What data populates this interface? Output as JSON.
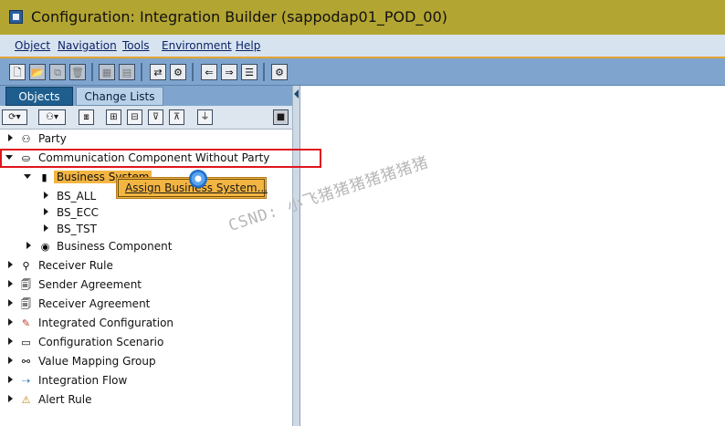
{
  "window": {
    "title": "Configuration: Integration Builder (sappodap01_POD_00)"
  },
  "menubar": {
    "items": [
      {
        "label": "Object"
      },
      {
        "label": "Navigation"
      },
      {
        "label": "Tools"
      },
      {
        "label": "Environment"
      },
      {
        "label": "Help"
      }
    ]
  },
  "tabs": [
    {
      "label": "Objects",
      "active": true
    },
    {
      "label": "Change Lists",
      "active": false
    }
  ],
  "tree": {
    "party": "Party",
    "ccwp": "Communication Component Without Party",
    "business_system": "Business System",
    "bs_all": "BS_ALL",
    "bs_ecc": "BS_ECC",
    "bs_tst": "BS_TST",
    "business_component": "Business Component",
    "receiver_rule": "Receiver Rule",
    "sender_agreement": "Sender Agreement",
    "receiver_agreement": "Receiver Agreement",
    "integrated_configuration": "Integrated Configuration",
    "configuration_scenario": "Configuration Scenario",
    "value_mapping_group": "Value Mapping Group",
    "integration_flow": "Integration Flow",
    "alert_rule": "Alert Rule"
  },
  "context_menu": {
    "item": "Assign Business System..."
  },
  "watermark": "CSND: 小飞猪猪猪猪猪猪猪",
  "colors": {
    "title_bar": "#b3a532",
    "menu_bar": "#d7e4f0",
    "toolbar": "#7fa5ce",
    "selection": "#f3b542",
    "highlight_box": "#e0141d"
  }
}
